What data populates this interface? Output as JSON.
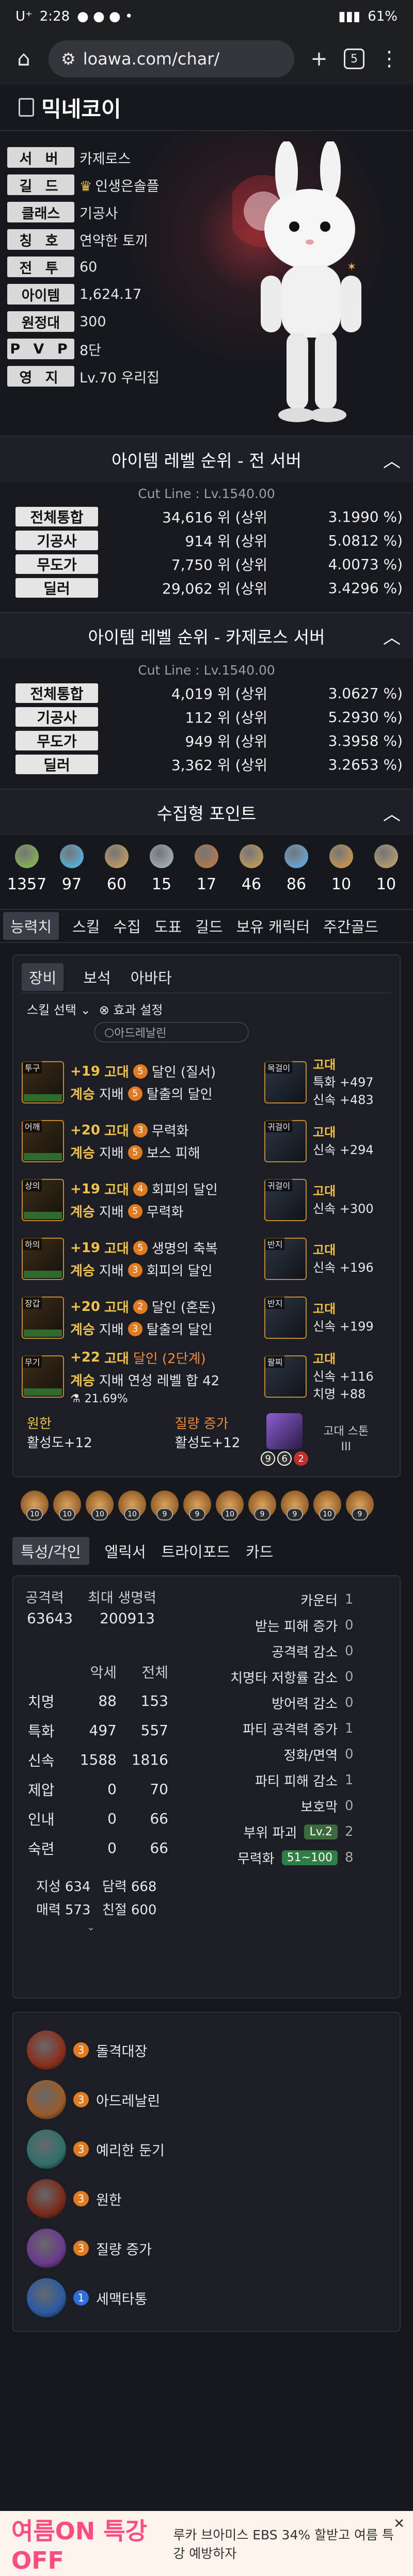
{
  "status": {
    "time": "2:28",
    "carrier": "U⁺",
    "battery": "61%"
  },
  "browser": {
    "url": "loawa.com/char/",
    "tab_count": "5"
  },
  "character": {
    "name": "믹네코이",
    "info": [
      {
        "key": "서 버",
        "value": "카제로스"
      },
      {
        "key": "길 드",
        "value": "인생은솔플"
      },
      {
        "key": "클래스",
        "value": "기공사"
      },
      {
        "key": "칭 호",
        "value": "연약한 토끼"
      },
      {
        "key": "전 투",
        "value": "60"
      },
      {
        "key": "아이템",
        "value": "1,624.17"
      },
      {
        "key": "원정대",
        "value": "300"
      },
      {
        "key": "P V P",
        "value": "8단"
      },
      {
        "key": "영 지",
        "value": "Lv.70 우리집"
      }
    ]
  },
  "rank_all": {
    "title": "아이템 레벨 순위 - 전 서버",
    "cut": "Cut Line : Lv.1540.00",
    "rows": [
      {
        "k": "전체통합",
        "rank": "34,616 위 (상위",
        "pct": "3.1990 %)"
      },
      {
        "k": "기공사",
        "rank": "914 위 (상위",
        "pct": "5.0812 %)"
      },
      {
        "k": "무도가",
        "rank": "7,750 위 (상위",
        "pct": "4.0073 %)"
      },
      {
        "k": "딜러",
        "rank": "29,062 위 (상위",
        "pct": "3.4296 %)"
      }
    ]
  },
  "rank_server": {
    "title": "아이템 레벨 순위 - 카제로스 서버",
    "cut": "Cut Line : Lv.1540.00",
    "rows": [
      {
        "k": "전체통합",
        "rank": "4,019 위 (상위",
        "pct": "3.0627 %)"
      },
      {
        "k": "기공사",
        "rank": "112 위 (상위",
        "pct": "5.2930 %)"
      },
      {
        "k": "무도가",
        "rank": "949 위 (상위",
        "pct": "3.3958 %)"
      },
      {
        "k": "딜러",
        "rank": "3,362 위 (상위",
        "pct": "3.2653 %)"
      }
    ]
  },
  "collect": {
    "title": "수집형 포인트",
    "items": [
      {
        "icon": "mokoko-seed-icon",
        "value": "1357",
        "color": "#8bc34a"
      },
      {
        "icon": "island-heart-icon",
        "value": "97",
        "color": "#4fc3f7"
      },
      {
        "icon": "great-art-icon",
        "value": "60",
        "color": "#d8a75a"
      },
      {
        "icon": "giant-heart-icon",
        "value": "15",
        "color": "#b0bec5"
      },
      {
        "icon": "ignea-token-icon",
        "value": "17",
        "color": "#c97a3a"
      },
      {
        "icon": "orpheus-star-icon",
        "value": "46",
        "color": "#d6a44e"
      },
      {
        "icon": "world-tree-leaf-icon",
        "value": "86",
        "color": "#64b5f6"
      },
      {
        "icon": "sea-bounty-icon",
        "value": "10",
        "color": "#e0a040"
      },
      {
        "icon": "orgel-icon",
        "value": "10",
        "color": "#c9a86b"
      }
    ]
  },
  "main_tabs": [
    "능력치",
    "스킬",
    "수집",
    "도표",
    "길드",
    "보유 캐릭터",
    "주간골드"
  ],
  "sub_tabs": [
    "장비",
    "보석",
    "아바타"
  ],
  "skill_select": {
    "label": "스킬 선택",
    "effect": "효과 설정",
    "option": "아드레날린"
  },
  "equipment": [
    {
      "slot": "투구",
      "level": "+19",
      "grade": "고대",
      "tier": "계승",
      "set": "지배",
      "e1lv": "5",
      "e1": "달인 (질서)",
      "e2lv": "5",
      "e2": "탈출의 달인"
    },
    {
      "slot": "어깨",
      "level": "+20",
      "grade": "고대",
      "tier": "계승",
      "set": "지배",
      "e1lv": "3",
      "e1": "무력화",
      "e2lv": "5",
      "e2": "보스 피해"
    },
    {
      "slot": "상의",
      "level": "+19",
      "grade": "고대",
      "tier": "계승",
      "set": "지배",
      "e1lv": "4",
      "e1": "회피의 달인",
      "e2lv": "5",
      "e2": "무력화"
    },
    {
      "slot": "하의",
      "level": "+19",
      "grade": "고대",
      "tier": "계승",
      "set": "지배",
      "e1lv": "5",
      "e1": "생명의 축복",
      "e2lv": "3",
      "e2": "회피의 달인"
    },
    {
      "slot": "장갑",
      "level": "+20",
      "grade": "고대",
      "tier": "계승",
      "set": "지배",
      "e1lv": "2",
      "e1": "달인 (혼돈)",
      "e2lv": "3",
      "e2": "탈출의 달인"
    },
    {
      "slot": "무기",
      "level": "+22",
      "grade": "고대",
      "tier": "계승",
      "set": "지배",
      "e1lv": "",
      "e1": "달인 (2단계)",
      "e2lv": "",
      "e2": "연성 레벨 합 42",
      "quality": "21.69%"
    }
  ],
  "accessories": [
    {
      "slot": "목걸이",
      "grade": "고대",
      "l1": "특화 +497",
      "l2": "신속 +483"
    },
    {
      "slot": "귀걸이",
      "grade": "고대",
      "l1": "신속 +294",
      "l2": ""
    },
    {
      "slot": "귀걸이",
      "grade": "고대",
      "l1": "신속 +300",
      "l2": ""
    },
    {
      "slot": "반지",
      "grade": "고대",
      "l1": "신속 +196",
      "l2": ""
    },
    {
      "slot": "반지",
      "grade": "고대",
      "l1": "신속 +199",
      "l2": ""
    },
    {
      "slot": "팔찌",
      "grade": "고대",
      "l1": "신속 +116",
      "l2": "치명 +88"
    }
  ],
  "elixir": {
    "h1": "원한",
    "h2": "질량 증가",
    "v1": "활성도+12",
    "v2": "활성도+12"
  },
  "stone": {
    "label1": "고대 스톤",
    "label2": "III",
    "n1": "9",
    "n2": "6",
    "n3": "2"
  },
  "gems": [
    "10",
    "10",
    "10",
    "10",
    "9",
    "9",
    "10",
    "9",
    "9",
    "10",
    "9"
  ],
  "tabs2": [
    "특성/각인",
    "엘릭서",
    "트라이포드",
    "카드"
  ],
  "stats": {
    "atk_label": "공격력",
    "hp_label": "최대 생명력",
    "atk": "63643",
    "hp": "200913",
    "hdr_a": "악세",
    "hdr_b": "전체",
    "rows": [
      {
        "k": "치명",
        "a": "88",
        "b": "153"
      },
      {
        "k": "특화",
        "a": "497",
        "b": "557"
      },
      {
        "k": "신속",
        "a": "1588",
        "b": "1816"
      },
      {
        "k": "제압",
        "a": "0",
        "b": "70"
      },
      {
        "k": "인내",
        "a": "0",
        "b": "66"
      },
      {
        "k": "숙련",
        "a": "0",
        "b": "66"
      }
    ],
    "attr": [
      {
        "k": "지성",
        "v": "634"
      },
      {
        "k": "담력",
        "v": "668"
      },
      {
        "k": "매력",
        "v": "573"
      },
      {
        "k": "친절",
        "v": "600"
      }
    ],
    "right": [
      {
        "k": "카운터",
        "v": "1"
      },
      {
        "k": "받는 피해 증가",
        "v": "0"
      },
      {
        "k": "공격력 감소",
        "v": "0"
      },
      {
        "k": "치명타 저항률 감소",
        "v": "0"
      },
      {
        "k": "방어력 감소",
        "v": "0"
      },
      {
        "k": "파티 공격력 증가",
        "v": "1"
      },
      {
        "k": "정화/면역",
        "v": "0"
      },
      {
        "k": "파티 피해 감소",
        "v": "1"
      },
      {
        "k": "보호막",
        "v": "0"
      },
      {
        "k": "부위 파괴",
        "v": "2",
        "pill": "Lv.2"
      },
      {
        "k": "무력화",
        "v": "8",
        "pill": "51~100"
      }
    ]
  },
  "engravings": [
    {
      "lv": "3",
      "name": "돌격대장",
      "color": "#8b2e1a"
    },
    {
      "lv": "3",
      "name": "아드레날린",
      "color": "#9a5b2a"
    },
    {
      "lv": "3",
      "name": "예리한 둔기",
      "color": "#2f6f6a"
    },
    {
      "lv": "3",
      "name": "원한",
      "color": "#7a2a18"
    },
    {
      "lv": "3",
      "name": "질량 증가",
      "color": "#6a3a8a"
    },
    {
      "lv": "1",
      "name": "세맥타통",
      "color": "#2a5aa0"
    }
  ],
  "ad": {
    "t1": "여름ON 특강OFF",
    "t2": "루카 브아미스 EBS 34% 할받고 여름 특강 예방하자"
  }
}
